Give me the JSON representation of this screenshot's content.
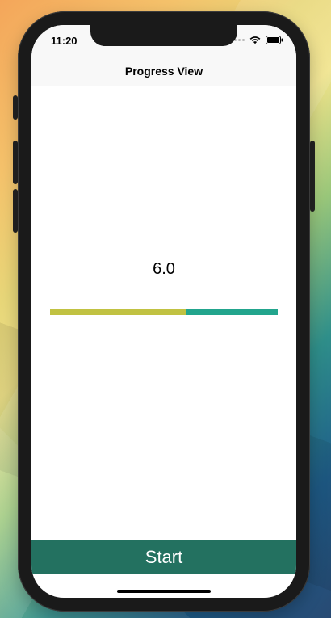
{
  "status_bar": {
    "time": "11:20",
    "signal_icon": "cellular-signal-icon",
    "wifi_icon": "wifi-icon",
    "battery_icon": "battery-icon"
  },
  "nav_bar": {
    "title": "Progress View"
  },
  "progress": {
    "label": "6.0",
    "fraction": 0.6,
    "fill_color": "#c1c242",
    "track_color": "#22a58d"
  },
  "actions": {
    "start_label": "Start",
    "start_color": "#237160"
  }
}
